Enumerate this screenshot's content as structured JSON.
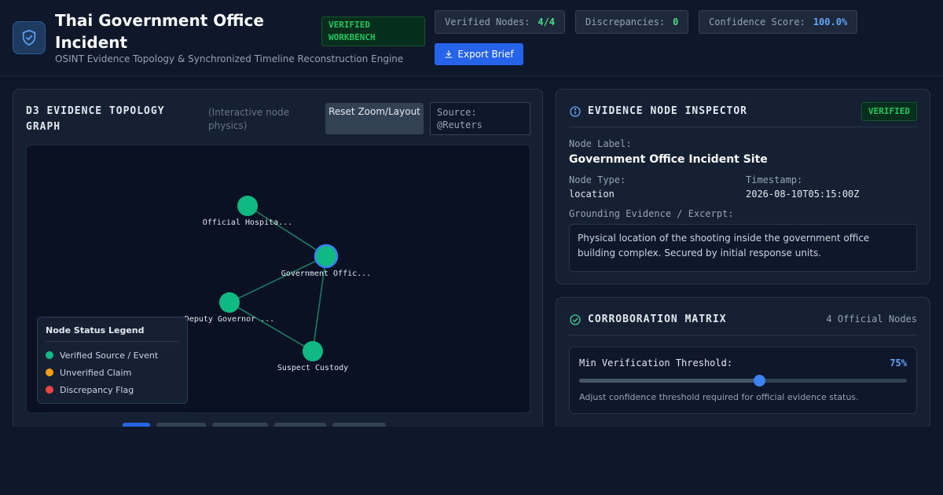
{
  "header": {
    "title": "Thai Government Office Incident",
    "badge": "VERIFIED WORKBENCH",
    "subtitle": "OSINT Evidence Topology & Synchronized Timeline Reconstruction Engine",
    "stats": [
      {
        "label": "Verified Nodes:",
        "value": "4/4",
        "color": "#4ade80"
      },
      {
        "label": "Discrepancies:",
        "value": "0",
        "color": "#4ade80"
      },
      {
        "label": "Confidence Score:",
        "value": "100.0%",
        "color": "#60a5fa"
      }
    ],
    "export_label": "Export Brief",
    "logo_icon": "shield-check-icon"
  },
  "graph": {
    "title": "D3 EVIDENCE TOPOLOGY GRAPH",
    "hint": "(Interactive node physics)",
    "reset_label": "Reset Zoom/Layout",
    "source": "Source: @Reuters",
    "nodes": [
      {
        "id": "hospital",
        "label": "Official Hospita...",
        "status": "verified"
      },
      {
        "id": "office",
        "label": "Government Offic...",
        "status": "verified",
        "selected": true
      },
      {
        "id": "deputy",
        "label": "Deputy Governor ...",
        "status": "verified"
      },
      {
        "id": "suspect",
        "label": "Suspect Custody",
        "status": "verified"
      }
    ],
    "edges": [
      [
        "hospital",
        "office"
      ],
      [
        "office",
        "deputy"
      ],
      [
        "office",
        "suspect"
      ],
      [
        "deputy",
        "suspect"
      ]
    ],
    "legend": {
      "title": "Node Status Legend",
      "items": [
        {
          "label": "Verified Source / Event",
          "color": "#10b981"
        },
        {
          "label": "Unverified Claim",
          "color": "#f59e0b"
        },
        {
          "label": "Discrepancy Flag",
          "color": "#ef4444"
        }
      ]
    }
  },
  "inspector": {
    "title": "EVIDENCE NODE INSPECTOR",
    "badge": "VERIFIED",
    "node_label_caption": "Node Label:",
    "node_label": "Government Office Incident Site",
    "type_caption": "Node Type:",
    "type": "location",
    "timestamp_caption": "Timestamp:",
    "timestamp": "2026-08-10T05:15:00Z",
    "excerpt_caption": "Grounding Evidence / Excerpt:",
    "excerpt": "Physical location of the shooting inside the government office building complex. Secured by initial response units."
  },
  "corroboration": {
    "title": "CORROBORATION MATRIX",
    "count": "4 Official Nodes",
    "threshold_label": "Min Verification Threshold:",
    "threshold_value": "75%",
    "threshold_fraction": 0.55,
    "help": "Adjust confidence threshold required for official evidence status."
  }
}
